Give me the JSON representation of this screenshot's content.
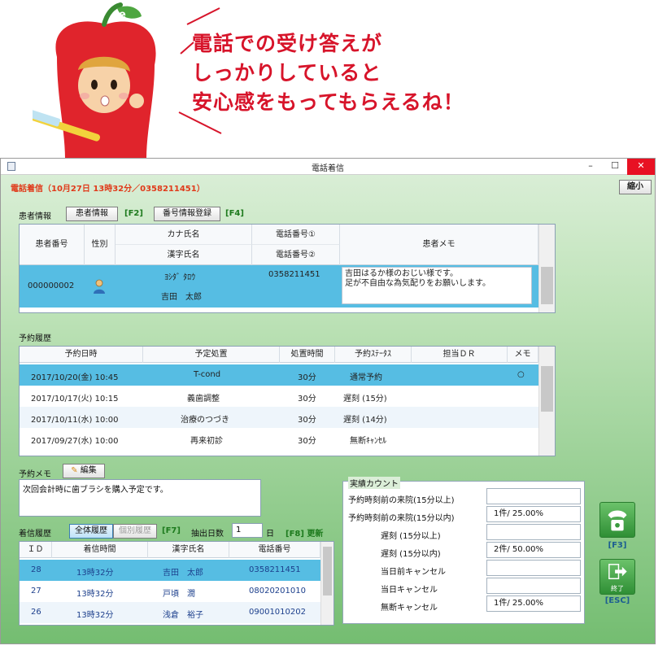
{
  "speech": {
    "line1": "電話での受け答えが",
    "line2": "しっかりしていると",
    "line3": "安心感をもってもらえるね！"
  },
  "window": {
    "title": "電話着信",
    "min_label": "–",
    "max_label": "☐",
    "close_label": "✕",
    "incoming_banner": "電話着信（10月27日 13時32分／0358211451）",
    "shrink_button": "縮小"
  },
  "patient": {
    "section_label": "患者情報",
    "info_button": "患者情報",
    "info_key": "[F2]",
    "register_button": "番号情報登録",
    "register_key": "[F4]",
    "headers": {
      "number": "患者番号",
      "sex": "性別",
      "kana_name": "カナ氏名",
      "kanji_name": "漢字氏名",
      "phone1": "電話番号①",
      "phone2": "電話番号②",
      "memo": "患者メモ"
    },
    "row": {
      "number": "000000002",
      "kana": "ﾖｼﾀﾞ ﾀﾛｳ",
      "kanji": "吉田　太郎",
      "phone1": "0358211451",
      "memo_line1": "吉田はるか様のおじい様です。",
      "memo_line2": "足が不自由な為気配りをお願いします。"
    }
  },
  "reservations": {
    "section_label": "予約履歴",
    "headers": [
      "予約日時",
      "予定処置",
      "処置時間",
      "予約ｽﾃｰﾀｽ",
      "担当ＤＲ",
      "メモ"
    ],
    "rows": [
      {
        "date": "2017/10/20(金) 10:45",
        "treatment": "T-cond",
        "duration": "30分",
        "status": "通常予約",
        "dr": "",
        "memo": "○"
      },
      {
        "date": "2017/10/17(火) 10:15",
        "treatment": "義歯調整",
        "duration": "30分",
        "status": "遅刻 (15分)",
        "dr": "",
        "memo": ""
      },
      {
        "date": "2017/10/11(水) 10:00",
        "treatment": "治療のつづき",
        "duration": "30分",
        "status": "遅刻 (14分)",
        "dr": "",
        "memo": ""
      },
      {
        "date": "2017/09/27(水) 10:00",
        "treatment": "再来初診",
        "duration": "30分",
        "status": "無断ｷｬﾝｾﾙ",
        "dr": "",
        "memo": ""
      }
    ]
  },
  "reservation_memo": {
    "label": "予約メモ",
    "edit_button": "編集",
    "text": "次回会計時に歯ブラシを購入予定です。"
  },
  "call_history": {
    "label": "着信履歴",
    "all_button": "全体履歴",
    "patient_button": "個別履歴",
    "key_f7": "[F7]",
    "days_label": "抽出日数",
    "days_value": "1",
    "days_unit": "日",
    "key_f8": "[F8] 更新",
    "headers": [
      "ＩＤ",
      "着信時間",
      "漢字氏名",
      "電話番号"
    ],
    "rows": [
      {
        "id": "28",
        "time": "13時32分",
        "name": "吉田　太郎",
        "phone": "0358211451"
      },
      {
        "id": "27",
        "time": "13時32分",
        "name": "戸頃　潤",
        "phone": "08020201010"
      },
      {
        "id": "26",
        "time": "13時32分",
        "name": "浅倉　裕子",
        "phone": "09001010202"
      }
    ]
  },
  "counts": {
    "title": "実績カウント",
    "items": [
      {
        "label": "予約時刻前の来院(15分以上)",
        "value": ""
      },
      {
        "label": "予約時刻前の来院(15分以内)",
        "value": "1件/ 25.00%"
      },
      {
        "label": "遅刻 (15分以上)",
        "value": ""
      },
      {
        "label": "遅刻 (15分以内)",
        "value": "2件/ 50.00%"
      },
      {
        "label": "当日前キャンセル",
        "value": ""
      },
      {
        "label": "当日キャンセル",
        "value": ""
      },
      {
        "label": "無断キャンセル",
        "value": "1件/ 25.00%"
      }
    ]
  },
  "actions": {
    "phone_icon": "phone-icon",
    "phone_key": "[F3]",
    "exit_icon": "exit-icon",
    "exit_caption": "終了",
    "exit_key": "[ESC]"
  },
  "colors": {
    "accent_red": "#d7142a",
    "selection_blue": "#56bde3",
    "fkey_green": "#1d7a1d"
  }
}
